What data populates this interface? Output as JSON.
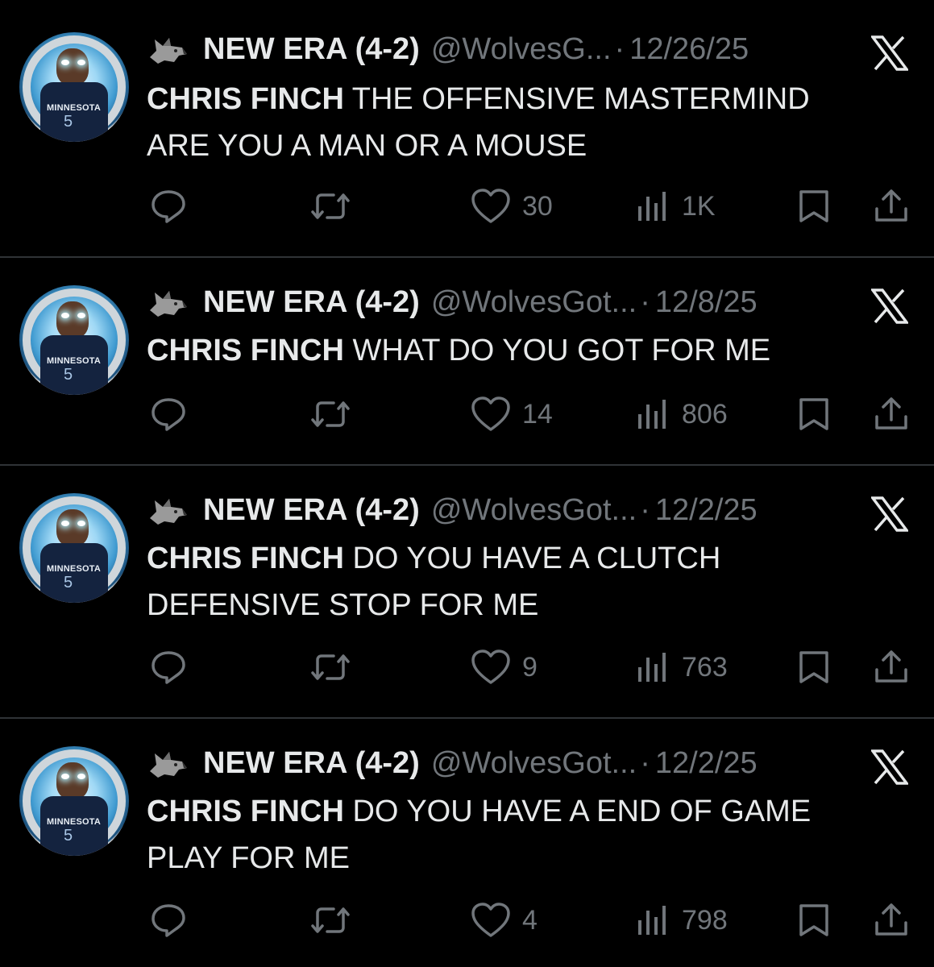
{
  "tweets": [
    {
      "display_name": "NEW ERA (4-2)",
      "handle": "@WolvesG...",
      "separator": "·",
      "date": "12/26/25",
      "text_bold": "CHRIS FINCH",
      "text_line1": " THE OFFENSIVE MASTERMIND",
      "text_line2": "ARE YOU A MAN OR A MOUSE",
      "likes": "30",
      "views": "1K",
      "avatar": {
        "jersey_text": "MINNESOTA",
        "jersey_number": "5"
      }
    },
    {
      "display_name": "NEW ERA (4-2)",
      "handle": "@WolvesGot...",
      "separator": "·",
      "date": "12/8/25",
      "text_bold": "CHRIS FINCH",
      "text_line1": " WHAT DO YOU GOT FOR ME",
      "text_line2": "",
      "likes": "14",
      "views": "806",
      "avatar": {
        "jersey_text": "MINNESOTA",
        "jersey_number": "5"
      }
    },
    {
      "display_name": "NEW ERA (4-2)",
      "handle": "@WolvesGot...",
      "separator": "·",
      "date": "12/2/25",
      "text_bold": "CHRIS FINCH",
      "text_line1": " DO YOU HAVE A CLUTCH",
      "text_line2": "DEFENSIVE STOP FOR ME",
      "likes": "9",
      "views": "763",
      "avatar": {
        "jersey_text": "MINNESOTA",
        "jersey_number": "5"
      }
    },
    {
      "display_name": "NEW ERA (4-2)",
      "handle": "@WolvesGot...",
      "separator": "·",
      "date": "12/2/25",
      "text_bold": "CHRIS FINCH",
      "text_line1": " DO YOU HAVE A END OF GAME",
      "text_line2": "PLAY FOR ME",
      "likes": "4",
      "views": "798",
      "avatar": {
        "jersey_text": "MINNESOTA",
        "jersey_number": "5"
      }
    }
  ],
  "icons": {
    "header": [
      "wolf-emoji-icon",
      "x-logo-icon"
    ],
    "actions": [
      "reply-icon",
      "retweet-icon",
      "like-icon",
      "views-icon",
      "bookmark-icon",
      "share-icon"
    ]
  },
  "colors": {
    "background": "#000000",
    "text_primary": "#e7e9ea",
    "text_secondary": "#71767b",
    "divider": "#2f3336"
  }
}
